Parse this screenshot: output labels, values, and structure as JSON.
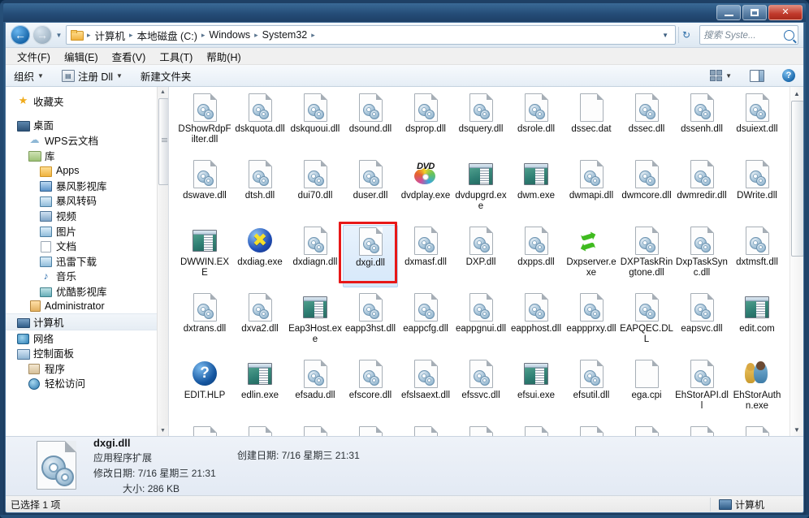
{
  "window": {
    "buttons": {
      "minimize": "minimize",
      "maximize": "maximize",
      "close": "✕"
    }
  },
  "address": {
    "back_icon": "back-arrow",
    "forward_icon": "forward-arrow",
    "crumbs": [
      "计算机",
      "本地磁盘 (C:)",
      "Windows",
      "System32"
    ],
    "separator": "▸",
    "dropdown_icon": "chevron-down-icon",
    "refresh_icon": "refresh-icon"
  },
  "search": {
    "placeholder": "搜索 Syste...",
    "value": "",
    "icon": "search-icon"
  },
  "menubar": {
    "items": [
      "文件(F)",
      "编辑(E)",
      "查看(V)",
      "工具(T)",
      "帮助(H)"
    ]
  },
  "toolbar": {
    "organize": "组织",
    "register_dll": "注册 Dll",
    "new_folder": "新建文件夹",
    "view_icon": "view-options-icon",
    "preview_pane_icon": "preview-pane-icon",
    "help_icon": "help-icon"
  },
  "sidebar": {
    "items": [
      {
        "label": "收藏夹",
        "icon": "star-icon",
        "indent": 0,
        "gap": false,
        "selected": false,
        "shape": "i-star"
      },
      {
        "label": "桌面",
        "icon": "desktop-icon",
        "indent": 0,
        "gap": true,
        "selected": false,
        "shape": "i-desktop"
      },
      {
        "label": "WPS云文档",
        "icon": "cloud-icon",
        "indent": 1,
        "gap": false,
        "selected": false,
        "shape": "i-cloud"
      },
      {
        "label": "库",
        "icon": "library-icon",
        "indent": 1,
        "gap": false,
        "selected": false,
        "shape": "i-lib"
      },
      {
        "label": "Apps",
        "icon": "folder-icon",
        "indent": 2,
        "gap": false,
        "selected": false,
        "shape": "i-folder"
      },
      {
        "label": "暴风影视库",
        "icon": "video-library-icon",
        "indent": 2,
        "gap": false,
        "selected": false,
        "shape": "i-blue"
      },
      {
        "label": "暴风转码",
        "icon": "transcode-icon",
        "indent": 2,
        "gap": false,
        "selected": false,
        "shape": "i-pic"
      },
      {
        "label": "视频",
        "icon": "videos-icon",
        "indent": 2,
        "gap": false,
        "selected": false,
        "shape": "i-video"
      },
      {
        "label": "图片",
        "icon": "pictures-icon",
        "indent": 2,
        "gap": false,
        "selected": false,
        "shape": "i-pic"
      },
      {
        "label": "文档",
        "icon": "documents-icon",
        "indent": 2,
        "gap": false,
        "selected": false,
        "shape": "i-doc"
      },
      {
        "label": "迅雷下载",
        "icon": "download-icon",
        "indent": 2,
        "gap": false,
        "selected": false,
        "shape": "i-pic"
      },
      {
        "label": "音乐",
        "icon": "music-icon",
        "indent": 2,
        "gap": false,
        "selected": false,
        "shape": "i-music"
      },
      {
        "label": "优酷影视库",
        "icon": "youku-library-icon",
        "indent": 2,
        "gap": false,
        "selected": false,
        "shape": "i-teal"
      },
      {
        "label": "Administrator",
        "icon": "user-icon",
        "indent": 1,
        "gap": false,
        "selected": false,
        "shape": "i-user"
      },
      {
        "label": "计算机",
        "icon": "computer-icon",
        "indent": 0,
        "gap": false,
        "selected": true,
        "shape": "i-computer"
      },
      {
        "label": "网络",
        "icon": "network-icon",
        "indent": 0,
        "gap": false,
        "selected": false,
        "shape": "i-network"
      },
      {
        "label": "控制面板",
        "icon": "control-panel-icon",
        "indent": 0,
        "gap": false,
        "selected": false,
        "shape": "i-ctrl"
      },
      {
        "label": "程序",
        "icon": "programs-icon",
        "indent": 1,
        "gap": false,
        "selected": false,
        "shape": "i-prog"
      },
      {
        "label": "轻松访问",
        "icon": "ease-of-access-icon",
        "indent": 1,
        "gap": false,
        "selected": false,
        "shape": "i-ease"
      }
    ]
  },
  "files": [
    {
      "name": "DShowRdpFilter.dll",
      "type": "dll"
    },
    {
      "name": "dskquota.dll",
      "type": "dll"
    },
    {
      "name": "dskquoui.dll",
      "type": "dll"
    },
    {
      "name": "dsound.dll",
      "type": "dll"
    },
    {
      "name": "dsprop.dll",
      "type": "dll"
    },
    {
      "name": "dsquery.dll",
      "type": "dll"
    },
    {
      "name": "dsrole.dll",
      "type": "dll"
    },
    {
      "name": "dssec.dat",
      "type": "blank"
    },
    {
      "name": "dssec.dll",
      "type": "dll"
    },
    {
      "name": "dssenh.dll",
      "type": "dll"
    },
    {
      "name": "dsuiext.dll",
      "type": "dll"
    },
    {
      "name": "dswave.dll",
      "type": "dll"
    },
    {
      "name": "dtsh.dll",
      "type": "dll"
    },
    {
      "name": "dui70.dll",
      "type": "dll"
    },
    {
      "name": "duser.dll",
      "type": "dll"
    },
    {
      "name": "dvdplay.exe",
      "type": "dvd"
    },
    {
      "name": "dvdupgrd.exe",
      "type": "exe"
    },
    {
      "name": "dwm.exe",
      "type": "exe"
    },
    {
      "name": "dwmapi.dll",
      "type": "dll"
    },
    {
      "name": "dwmcore.dll",
      "type": "dll"
    },
    {
      "name": "dwmredir.dll",
      "type": "dll"
    },
    {
      "name": "DWrite.dll",
      "type": "dll"
    },
    {
      "name": "DWWIN.EXE",
      "type": "exe"
    },
    {
      "name": "dxdiag.exe",
      "type": "xball"
    },
    {
      "name": "dxdiagn.dll",
      "type": "dll"
    },
    {
      "name": "dxgi.dll",
      "type": "dll",
      "selected": true,
      "highlighted": true
    },
    {
      "name": "dxmasf.dll",
      "type": "dll"
    },
    {
      "name": "DXP.dll",
      "type": "dll"
    },
    {
      "name": "dxpps.dll",
      "type": "dll"
    },
    {
      "name": "Dxpserver.exe",
      "type": "recycle"
    },
    {
      "name": "DXPTaskRingtone.dll",
      "type": "dll"
    },
    {
      "name": "DxpTaskSync.dll",
      "type": "dll"
    },
    {
      "name": "dxtmsft.dll",
      "type": "dll"
    },
    {
      "name": "dxtrans.dll",
      "type": "dll"
    },
    {
      "name": "dxva2.dll",
      "type": "dll"
    },
    {
      "name": "Eap3Host.exe",
      "type": "exe"
    },
    {
      "name": "eapp3hst.dll",
      "type": "dll"
    },
    {
      "name": "eappcfg.dll",
      "type": "dll"
    },
    {
      "name": "eappgnui.dll",
      "type": "dll"
    },
    {
      "name": "eapphost.dll",
      "type": "dll"
    },
    {
      "name": "eappprxy.dll",
      "type": "dll"
    },
    {
      "name": "EAPQEC.DLL",
      "type": "dll"
    },
    {
      "name": "eapsvc.dll",
      "type": "dll"
    },
    {
      "name": "edit.com",
      "type": "exe"
    },
    {
      "name": "EDIT.HLP",
      "type": "help"
    },
    {
      "name": "edlin.exe",
      "type": "exe"
    },
    {
      "name": "efsadu.dll",
      "type": "dll"
    },
    {
      "name": "efscore.dll",
      "type": "dll"
    },
    {
      "name": "efslsaext.dll",
      "type": "dll"
    },
    {
      "name": "efssvc.dll",
      "type": "dll"
    },
    {
      "name": "efsui.exe",
      "type": "exe"
    },
    {
      "name": "efsutil.dll",
      "type": "dll"
    },
    {
      "name": "ega.cpi",
      "type": "blank"
    },
    {
      "name": "EhStorAPI.dll",
      "type": "dll"
    },
    {
      "name": "EhStorAuthn.exe",
      "type": "users"
    },
    {
      "name": "",
      "type": "dll"
    },
    {
      "name": "",
      "type": "dll"
    },
    {
      "name": "",
      "type": "dll"
    },
    {
      "name": "",
      "type": "dll"
    },
    {
      "name": "",
      "type": "dll"
    },
    {
      "name": "",
      "type": "dll"
    },
    {
      "name": "",
      "type": "dll"
    },
    {
      "name": "",
      "type": "dll"
    },
    {
      "name": "",
      "type": "dll"
    },
    {
      "name": "",
      "type": "dll"
    },
    {
      "name": "",
      "type": "dll"
    }
  ],
  "details": {
    "filename": "dxgi.dll",
    "filetype": "应用程序扩展",
    "modified_label": "修改日期:",
    "modified_value": "7/16 星期三 21:31",
    "size_label": "大小:",
    "size_value": "286 KB",
    "created_label": "创建日期:",
    "created_value": "7/16 星期三 21:31"
  },
  "statusbar": {
    "selection": "已选择 1 项",
    "location": "计算机",
    "location_icon": "computer-icon"
  },
  "colors": {
    "highlight_red": "#e71818",
    "selection_blue": "#d6e8fa",
    "chrome_blue": "#20456a"
  }
}
